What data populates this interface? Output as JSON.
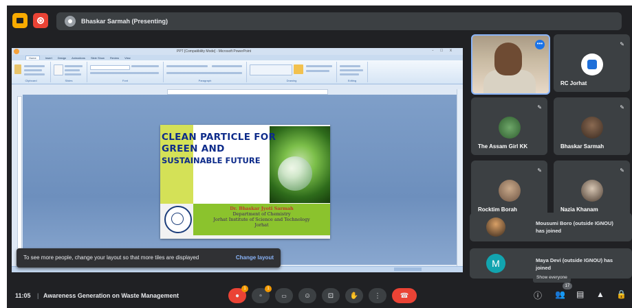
{
  "topbar": {
    "presenter": "Bhaskar Sarmah (Presenting)"
  },
  "ppt": {
    "window_title": "PPT [Compatibility Mode] - Microsoft PowerPoint",
    "tabs": [
      "Home",
      "Insert",
      "Design",
      "Animations",
      "Slide Show",
      "Review",
      "View"
    ],
    "groups": [
      "Clipboard",
      "Slides",
      "Font",
      "Paragraph",
      "Drawing",
      "Editing"
    ]
  },
  "slide": {
    "title_lines": [
      "CLEAN PARTICLE FOR",
      "GREEN AND",
      "SUSTAINABLE FUTURE"
    ],
    "author": "Dr. Bhaskar Jyoti Sarmah",
    "department": "Department of Chemistry",
    "institute": "Jorhat Institute of Science and Technology",
    "city": "Jorhat"
  },
  "participants": [
    {
      "name": "",
      "more_label": "•••"
    },
    {
      "name": "RC Jorhat"
    },
    {
      "name": "The Assam Girl KK"
    },
    {
      "name": "Bhaskar Sarmah"
    },
    {
      "name": "Rocktim Borah"
    },
    {
      "name": "Nazia Khanam"
    }
  ],
  "notifications": [
    {
      "text": "Mousumi Boro (outside IGNOU) has joined"
    },
    {
      "text": "Maya Devi (outside IGNOU) has joined",
      "initial": "M"
    }
  ],
  "snackbar": {
    "message": "To see more people, change your layout so that more tiles are displayed",
    "action": "Change layout"
  },
  "tooltip": "Show everyone",
  "people_count": "17",
  "bottombar": {
    "time": "11:05",
    "separator": "|",
    "meeting_title": "Awareness Generation on Waste Management",
    "badge_count": "1"
  },
  "icons": {
    "mic": "mic-off-icon",
    "cam": "camera-off-icon",
    "captions": "captions-icon",
    "emoji": "emoji-icon",
    "present": "present-icon",
    "hand": "raise-hand-icon",
    "more": "more-options-icon",
    "end": "end-call-icon",
    "info": "info-icon",
    "people": "people-icon",
    "chat": "chat-icon",
    "activities": "activities-icon",
    "lock": "host-controls-icon"
  },
  "colors": {
    "accent": "#8ab4f8",
    "end_call": "#ea4335",
    "badge": "#f29900",
    "present_yellow": "#f9ab00"
  }
}
